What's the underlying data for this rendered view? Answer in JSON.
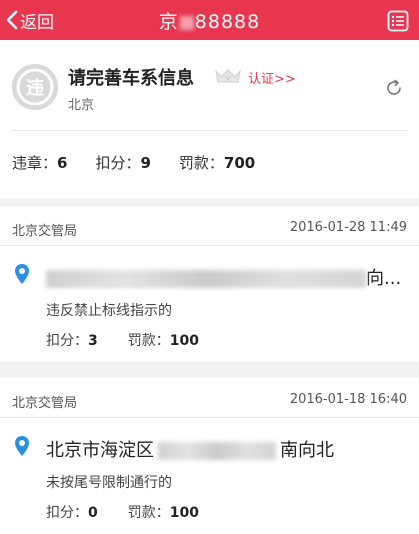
{
  "nav": {
    "back_label": "返回",
    "plate_prefix": "京",
    "plate_suffix": "88888",
    "accent": "#e8364f"
  },
  "car": {
    "logo_char": "违",
    "title": "请完善车系信息",
    "verify_label": "认证>>",
    "city": "北京",
    "stats": {
      "violations_label": "违章：",
      "violations": "6",
      "points_label": "扣分：",
      "points": "9",
      "fine_label": "罚款：",
      "fine": "700"
    }
  },
  "violations": [
    {
      "dept": "北京交管局",
      "time": "2016-01-28 11:49",
      "address_suffix": "向...",
      "desc": "违反禁止标线指示的",
      "points_label": "扣分：",
      "points": "3",
      "fine_label": "罚款：",
      "fine": "100"
    },
    {
      "dept": "北京交管局",
      "time": "2016-01-18 16:40",
      "address_prefix": "北京市海淀区",
      "address_suffix": "南向北",
      "desc": "未按尾号限制通行的",
      "points_label": "扣分：",
      "points": "0",
      "fine_label": "罚款：",
      "fine": "100"
    }
  ]
}
